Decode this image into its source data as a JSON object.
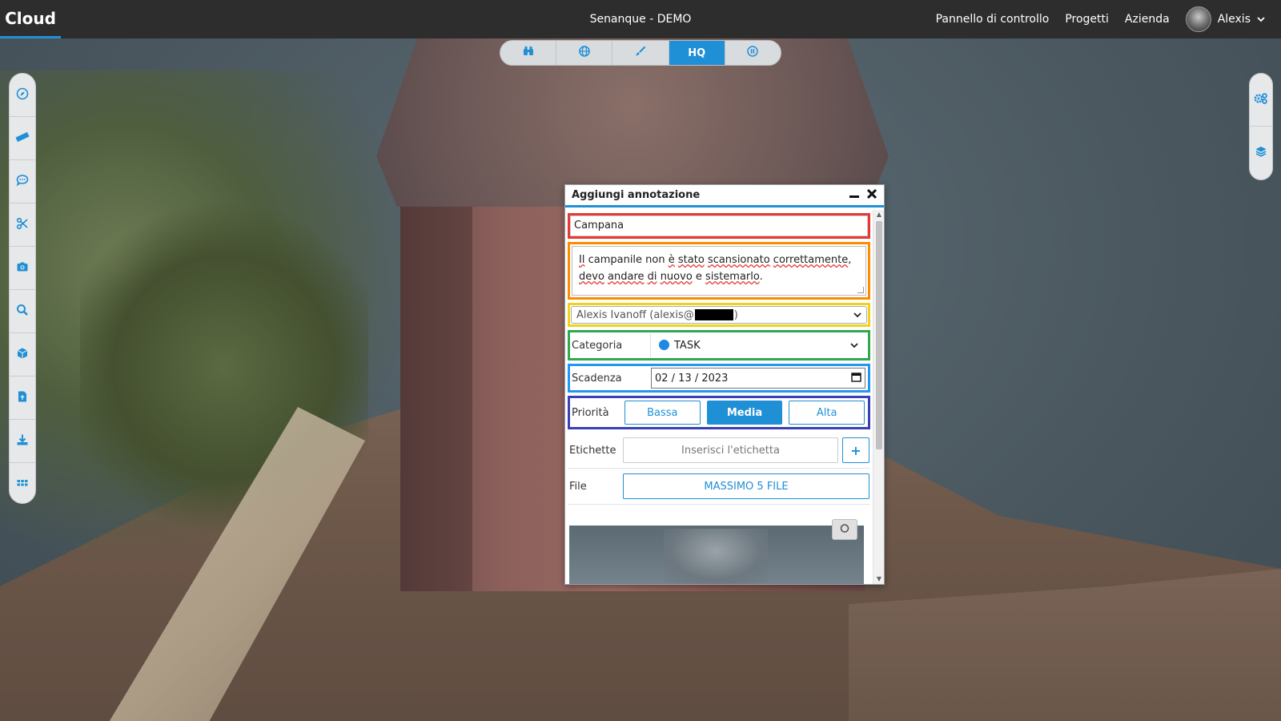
{
  "header": {
    "brand": "Cloud",
    "title": "Senanque - DEMO",
    "nav": [
      "Pannello di controllo",
      "Progetti",
      "Azienda"
    ],
    "user_name": "Alexis"
  },
  "viewbar": {
    "items": [
      {
        "icon": "binoculars-icon",
        "label": ""
      },
      {
        "icon": "globe-icon",
        "label": ""
      },
      {
        "icon": "brush-icon",
        "label": ""
      },
      {
        "icon": "hq-label",
        "label": "HQ"
      },
      {
        "icon": "pause-icon",
        "label": ""
      }
    ],
    "active": "HQ"
  },
  "left_tools": [
    "compass-icon",
    "ruler-icon",
    "comment-icon",
    "scissors-icon",
    "camera-icon",
    "search-icon",
    "cube-icon",
    "document-icon",
    "download-icon",
    "grid-icon"
  ],
  "right_tools": [
    "settings-icon",
    "layers-icon"
  ],
  "dialog": {
    "title": "Aggiungi annotazione",
    "annotation_title": "Campana",
    "description": {
      "line1": [
        "Il",
        " campanile non ",
        "è",
        " ",
        "stato",
        " ",
        "scansionato",
        " ",
        "correttamente",
        ","
      ],
      "line2": [
        "devo",
        " ",
        "andare",
        " ",
        "di",
        " ",
        "nuovo",
        " e ",
        "sistemarlo",
        "."
      ]
    },
    "assignee_prefix": "Alexis Ivanoff (alexis@",
    "assignee_suffix": ")",
    "category_label": "Categoria",
    "category_value": "TASK",
    "deadline_label": "Scadenza",
    "deadline_value": "02 / 13 / 2023",
    "priority_label": "Priorità",
    "priority_options": [
      "Bassa",
      "Media",
      "Alta"
    ],
    "priority_selected": "Media",
    "tags_label": "Etichette",
    "tags_placeholder": "Inserisci l'etichetta",
    "tags_add": "+",
    "file_label": "File",
    "file_button": "MASSIMO 5 FILE"
  },
  "colors": {
    "accent": "#1f8fd6",
    "topbar": "#2d2d2d",
    "highlight_red": "#e53935",
    "highlight_orange": "#fb8c00",
    "highlight_yellow": "#f1d21a",
    "highlight_green": "#2fa84f",
    "highlight_blue": "#2196f3",
    "highlight_indigo": "#3a3fb5"
  }
}
